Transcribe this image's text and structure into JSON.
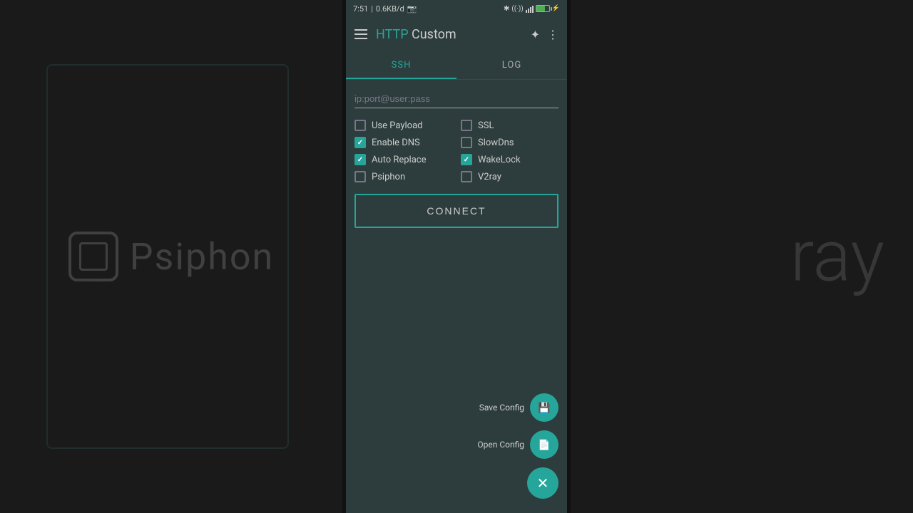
{
  "background": {
    "psiphon_label": "Psiphon",
    "ray_label": "ray"
  },
  "status_bar": {
    "time": "7:51",
    "speed": "0.6KB/d",
    "battery_percent": "70"
  },
  "header": {
    "title_http": "HTTP",
    "title_custom": " Custom",
    "menu_icon": "☰",
    "star_icon": "✦",
    "more_icon": "⋮"
  },
  "tabs": [
    {
      "label": "SSH",
      "active": true
    },
    {
      "label": "LOG",
      "active": false
    }
  ],
  "server_input": {
    "placeholder": "ip:port@user:pass",
    "value": ""
  },
  "checkboxes": [
    {
      "id": "use-payload",
      "label": "Use Payload",
      "checked": false
    },
    {
      "id": "ssl",
      "label": "SSL",
      "checked": false
    },
    {
      "id": "enable-dns",
      "label": "Enable DNS",
      "checked": true
    },
    {
      "id": "slow-dns",
      "label": "SlowDns",
      "checked": false
    },
    {
      "id": "auto-replace",
      "label": "Auto Replace",
      "checked": true
    },
    {
      "id": "wakelock",
      "label": "WakeLock",
      "checked": true
    },
    {
      "id": "psiphon",
      "label": "Psiphon",
      "checked": false
    },
    {
      "id": "v2ray",
      "label": "V2ray",
      "checked": false
    }
  ],
  "connect_button": {
    "label": "CONNECT"
  },
  "fab_buttons": [
    {
      "label": "Save Config",
      "icon": "💾"
    },
    {
      "label": "Open Config",
      "icon": "📄"
    }
  ],
  "fab_close": {
    "icon": "✕"
  }
}
